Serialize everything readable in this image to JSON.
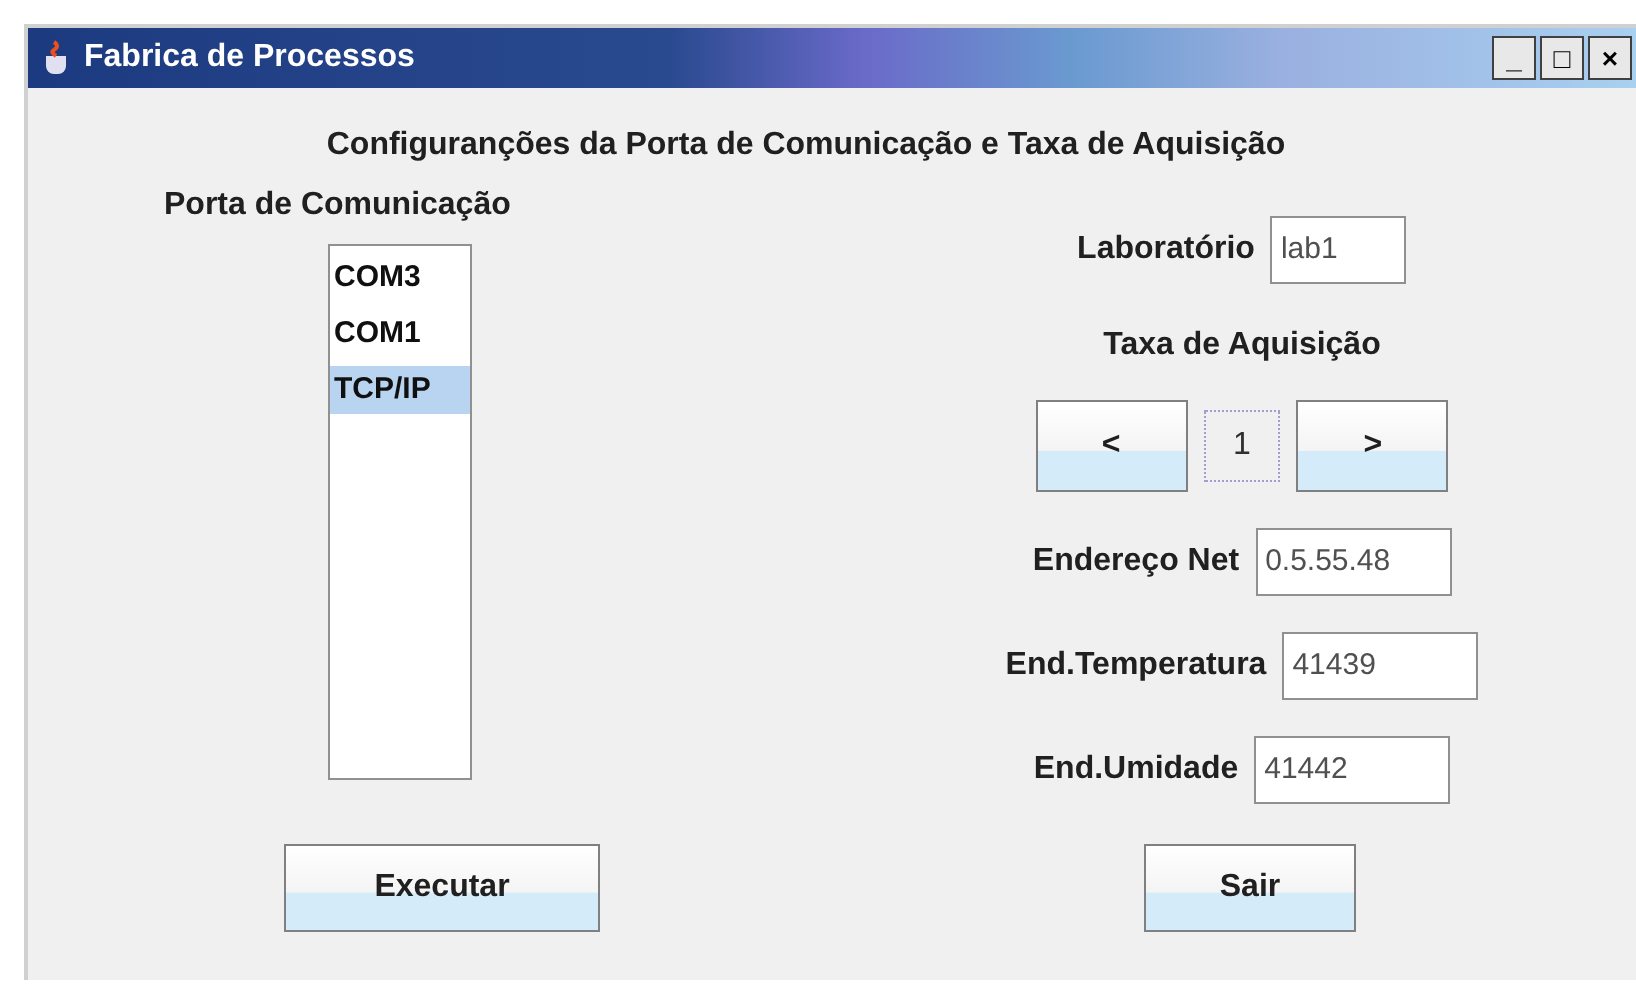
{
  "window": {
    "title": "Fabrica de Processos",
    "controls": [
      "_",
      "□",
      "×"
    ]
  },
  "heading": "Configuranções da Porta de Comunicação e Taxa de Aquisição",
  "port": {
    "label": "Porta de Comunicação",
    "items": [
      {
        "label": "COM3",
        "selected": false
      },
      {
        "label": "COM1",
        "selected": false
      },
      {
        "label": "TCP/IP",
        "selected": true
      }
    ]
  },
  "laboratory": {
    "label": "Laboratório",
    "value": "lab1"
  },
  "rate": {
    "label": "Taxa de Aquisição",
    "decrease": "<",
    "value": "1",
    "increase": ">"
  },
  "addresses": [
    {
      "label": "Endereço Net",
      "value": "0.5.55.48"
    },
    {
      "label": "End.Temperatura",
      "value": "41439"
    },
    {
      "label": "End.Umidade",
      "value": "41442"
    }
  ],
  "buttons": [
    "Executar",
    "Sair"
  ]
}
